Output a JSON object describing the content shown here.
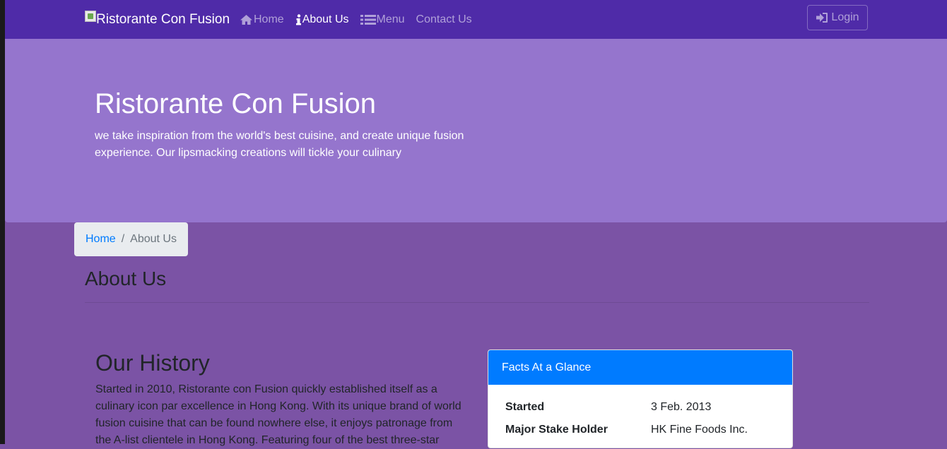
{
  "navbar": {
    "brand": "Ristorante Con Fusion",
    "items": [
      {
        "label": "Home",
        "icon": "home-icon",
        "active": false
      },
      {
        "label": "About Us",
        "icon": "info-icon",
        "active": true
      },
      {
        "label": "Menu",
        "icon": "list-icon",
        "active": false
      },
      {
        "label": "Contact Us",
        "icon": "",
        "active": false
      }
    ],
    "login_label": "Login",
    "login_icon": "sign-in-icon"
  },
  "jumbotron": {
    "title": "Ristorante Con Fusion",
    "tagline": "we take inspiration from the world's best cuisine, and create unique fusion experience. Our lipsmacking creations will tickle your culinary"
  },
  "breadcrumb": {
    "home": "Home",
    "separator": "/",
    "current": "About Us"
  },
  "page": {
    "title": "About Us"
  },
  "history": {
    "title": "Our History",
    "text": "Started in 2010, Ristorante con Fusion quickly established itself as a culinary icon par excellence in Hong Kong. With its unique brand of world fusion cuisine that can be found nowhere else, it enjoys patronage from the A-list clientele in Hong Kong. Featuring four of the best three-star"
  },
  "facts": {
    "header": "Facts At a Glance",
    "rows": [
      {
        "term": "Started",
        "value": "3 Feb. 2013"
      },
      {
        "term": "Major Stake Holder",
        "value": "HK Fine Foods Inc."
      }
    ]
  },
  "colors": {
    "navbar": "#4f2ba8",
    "jumbotron": "#9575cd",
    "body": "#7b53a5",
    "card_header": "#007bff"
  }
}
